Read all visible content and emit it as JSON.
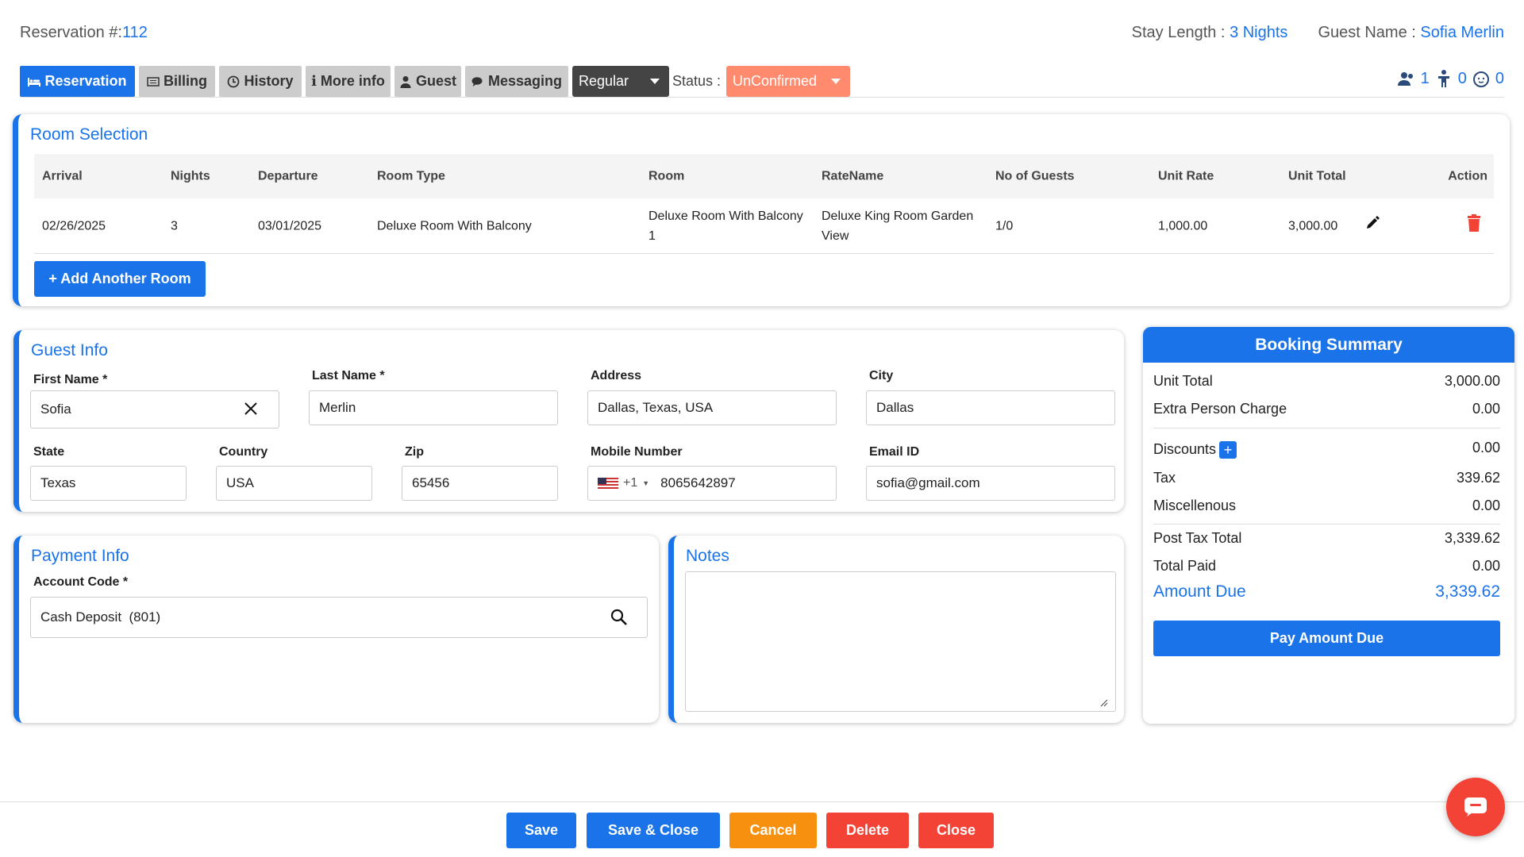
{
  "header": {
    "reservation_label": "Reservation #:",
    "reservation_no": "112",
    "stay_label": "Stay Length :",
    "stay_value": "3 Nights",
    "guest_label": "Guest Name :",
    "guest_value": "Sofia Merlin"
  },
  "tabs": [
    "Reservation",
    "Billing",
    "History",
    "More info",
    "Guest",
    "Messaging"
  ],
  "rate_select": "Regular",
  "status": {
    "label": "Status :",
    "value": "UnConfirmed"
  },
  "occupancy": {
    "adults": "1",
    "children": "0",
    "infants": "0"
  },
  "room_selection": {
    "title": "Room Selection",
    "headers": [
      "Arrival",
      "Nights",
      "Departure",
      "Room Type",
      "Room",
      "RateName",
      "No of Guests",
      "Unit Rate",
      "Unit Total",
      "Action"
    ],
    "row": {
      "arrival": "02/26/2025",
      "nights": "3",
      "departure": "03/01/2025",
      "room_type": "Deluxe Room With Balcony",
      "room_line1": "Deluxe Room With Balcony",
      "room_line2": "1",
      "rate_line1": "Deluxe King Room Garden",
      "rate_line2": "View",
      "guests": "1/0",
      "unit_rate": "1,000.00",
      "unit_total": "3,000.00"
    },
    "add_button": "+ Add Another Room"
  },
  "guest_info": {
    "title": "Guest Info",
    "first_name_label": "First Name *",
    "first_name": "Sofia",
    "last_name_label": "Last Name *",
    "last_name": "Merlin",
    "address_label": "Address",
    "address": "Dallas, Texas, USA",
    "city_label": "City",
    "city": "Dallas",
    "state_label": "State",
    "state": "Texas",
    "country_label": "Country",
    "country": "USA",
    "zip_label": "Zip",
    "zip": "65456",
    "mobile_label": "Mobile Number",
    "dial_code": "+1",
    "mobile": "8065642897",
    "email_label": "Email ID",
    "email": "sofia@gmail.com"
  },
  "payment_info": {
    "title": "Payment Info",
    "account_label": "Account Code *",
    "account_value": "Cash Deposit  (801)"
  },
  "notes": {
    "title": "Notes",
    "value": ""
  },
  "booking_summary": {
    "title": "Booking Summary",
    "unit_total_label": "Unit Total",
    "unit_total": "3,000.00",
    "extra_label": "Extra Person Charge",
    "extra": "0.00",
    "discounts_label": "Discounts",
    "discounts": "0.00",
    "tax_label": "Tax",
    "tax": "339.62",
    "misc_label": "Miscellenous",
    "misc": "0.00",
    "post_tax_label": "Post Tax Total",
    "post_tax": "3,339.62",
    "paid_label": "Total Paid",
    "paid": "0.00",
    "due_label": "Amount Due",
    "due": "3,339.62",
    "pay_button": "Pay Amount Due"
  },
  "footer": {
    "save": "Save",
    "save_close": "Save & Close",
    "cancel": "Cancel",
    "delete": "Delete",
    "close": "Close"
  },
  "colors": {
    "primary": "#1a73e8",
    "status": "#ff8a6e",
    "cancel": "#f7900f",
    "danger": "#f34336",
    "select": "#444444"
  }
}
